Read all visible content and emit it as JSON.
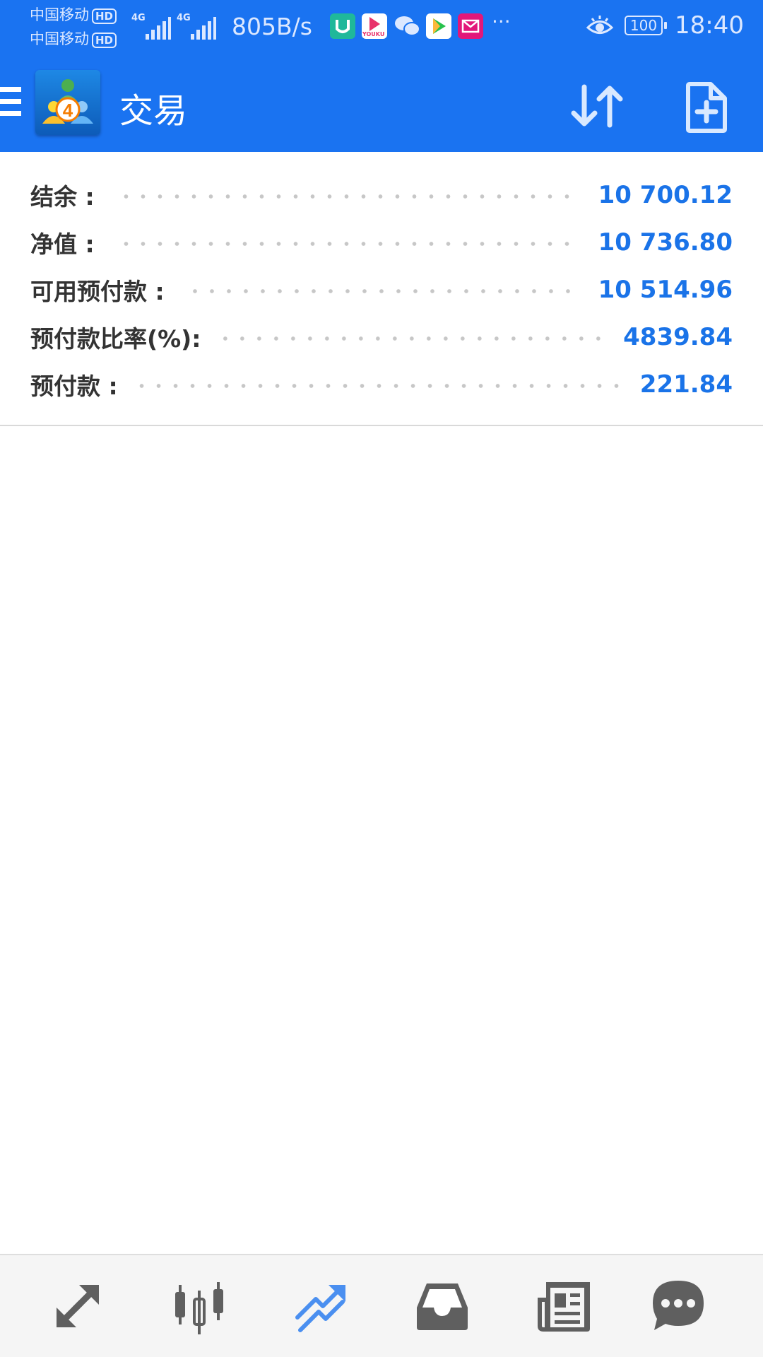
{
  "status_bar": {
    "carrier1": "中国移动",
    "carrier2": "中国移动",
    "hd_badge": "HD",
    "network_type": "4G",
    "net_speed": "805B/s",
    "more": "···",
    "battery": "100",
    "time": "18:40",
    "app_icons": [
      "mi-home-icon",
      "youku-icon",
      "wechat-icon",
      "video-play-icon",
      "mail-icon"
    ],
    "youku_text": "YOUKU"
  },
  "toolbar": {
    "title": "交易",
    "logo_number": "4",
    "color": "#1a73f1"
  },
  "summary": {
    "rows": [
      {
        "label": "结余 :",
        "value": "10 700.12"
      },
      {
        "label": "净值 :",
        "value": "10 736.80"
      },
      {
        "label": "可用预付款 :",
        "value": "10 514.96"
      },
      {
        "label": "预付款比率(%):",
        "value": "4839.84"
      },
      {
        "label": "预付款 :",
        "value": "221.84"
      }
    ],
    "value_color": "#1a73e8"
  },
  "bottom_nav": {
    "items": [
      {
        "icon": "quotes-arrows-icon",
        "active": false
      },
      {
        "icon": "chart-candles-icon",
        "active": false
      },
      {
        "icon": "trade-icon",
        "active": true
      },
      {
        "icon": "history-inbox-icon",
        "active": false
      },
      {
        "icon": "news-icon",
        "active": false
      },
      {
        "icon": "chat-icon",
        "active": false
      }
    ],
    "active_color": "#4a8ff0",
    "inactive_color": "#5f5f5f"
  }
}
